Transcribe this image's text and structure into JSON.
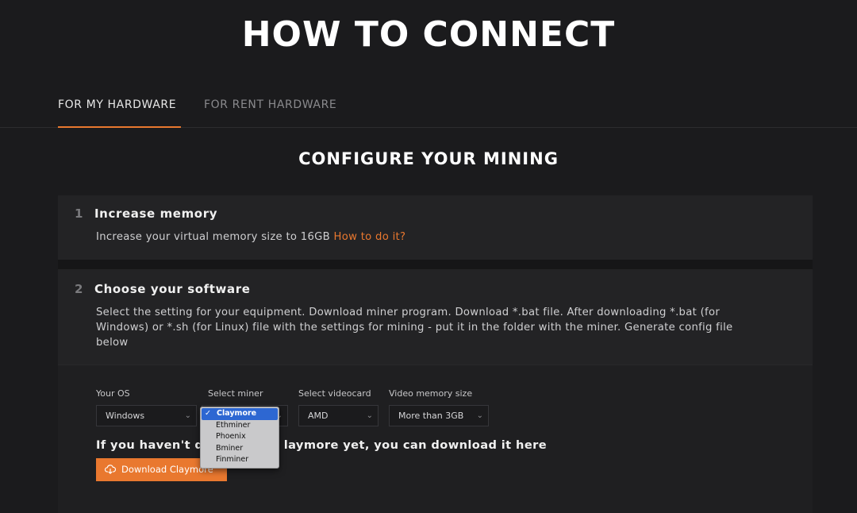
{
  "page": {
    "title": "HOW TO CONNECT"
  },
  "tabs": [
    {
      "label": "FOR MY HARDWARE",
      "active": true
    },
    {
      "label": "FOR RENT HARDWARE",
      "active": false
    }
  ],
  "section_title": "CONFIGURE YOUR MINING",
  "steps": [
    {
      "num": "1",
      "title": "Increase memory",
      "text": "Increase your virtual memory size to 16GB",
      "link": "How to do it?"
    },
    {
      "num": "2",
      "title": "Choose your software",
      "text_lines": [
        "Select the setting for your equipment. Download miner program. Download *.bat file. After downloading *.bat (for",
        "Windows) or *.sh (for Linux) file with the settings for mining - put it in the folder with the miner. Generate config file",
        "below"
      ]
    }
  ],
  "config": {
    "os": {
      "label": "Your OS",
      "value": "Windows"
    },
    "miner": {
      "label": "Select miner",
      "options": [
        "Claymore",
        "Ethminer",
        "Phoenix",
        "Bminer",
        "Finminer"
      ],
      "selected": "Claymore",
      "check": "✓"
    },
    "videocard": {
      "label": "Select videocard",
      "value": "AMD"
    },
    "memory": {
      "label": "Video memory size",
      "value": "More than 3GB"
    },
    "chevron": "⌄"
  },
  "download": {
    "text_before": "If you haven't do",
    "text_after": "laymore yet, you can download it here",
    "button_label": "Download Claymore",
    "icon": "cloud-download-icon",
    "accent": "#e9782f"
  }
}
